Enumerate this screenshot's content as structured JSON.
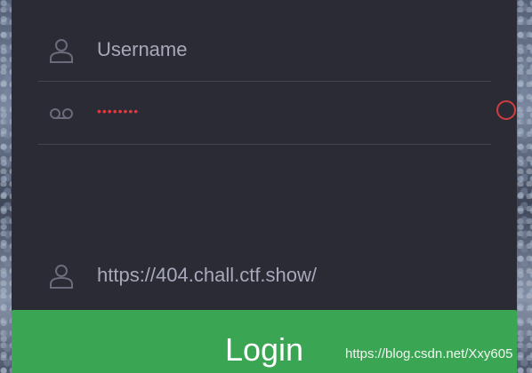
{
  "form": {
    "username_placeholder": "Username",
    "password_masked": "••••••••",
    "url_value": "https://404.chall.ctf.show/",
    "login_label": "Login"
  },
  "watermark": "https://blog.csdn.net/Xxy605",
  "colors": {
    "panel": "#2b2b36",
    "accent": "#3aa552",
    "error": "#e0393e",
    "text_muted": "#a7a9bb"
  },
  "icons": {
    "username": "user-icon",
    "password": "voicemail-icon",
    "url": "user-icon"
  }
}
